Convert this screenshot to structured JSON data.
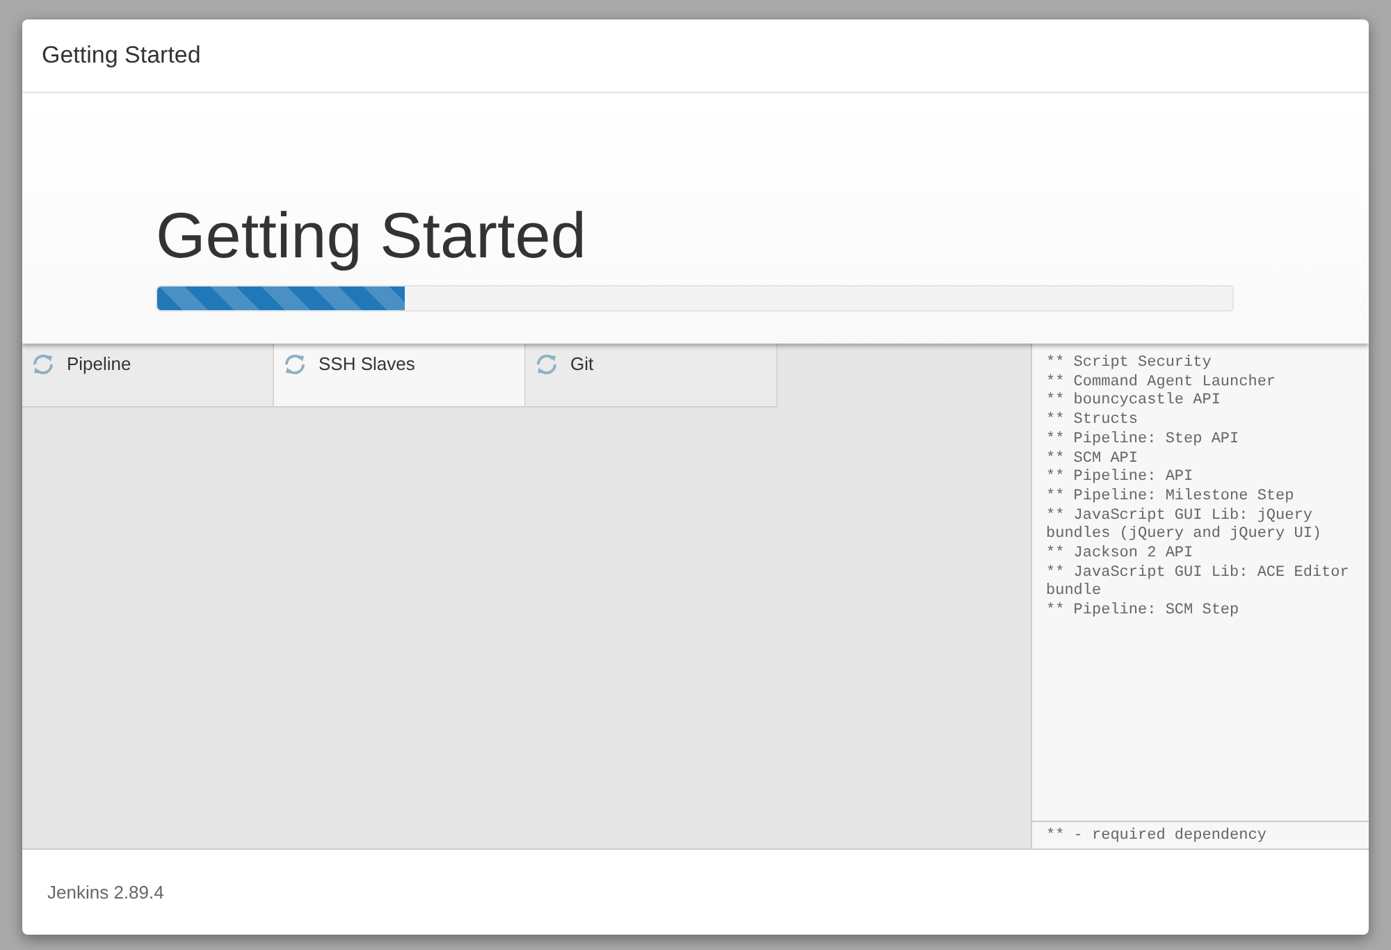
{
  "window": {
    "title": "Getting Started"
  },
  "hero": {
    "title": "Getting Started",
    "progress": {
      "level": 0.23
    }
  },
  "plugins": [
    {
      "name": "Pipeline",
      "installing": false
    },
    {
      "name": "SSH Slaves",
      "installing": true
    },
    {
      "name": "Git",
      "installing": false
    }
  ],
  "log": {
    "lines": [
      "** Script Security",
      "** Command Agent Launcher",
      "** bouncycastle API",
      "** Structs",
      "** Pipeline: Step API",
      "** SCM API",
      "** Pipeline: API",
      "** Pipeline: Milestone Step",
      "** JavaScript GUI Lib: jQuery bundles (jQuery and jQuery UI)",
      "** Jackson 2 API",
      "** JavaScript GUI Lib: ACE Editor bundle",
      "** Pipeline: SCM Step"
    ],
    "legend": "** - required dependency"
  },
  "footer": {
    "version": "Jenkins 2.89.4"
  }
}
